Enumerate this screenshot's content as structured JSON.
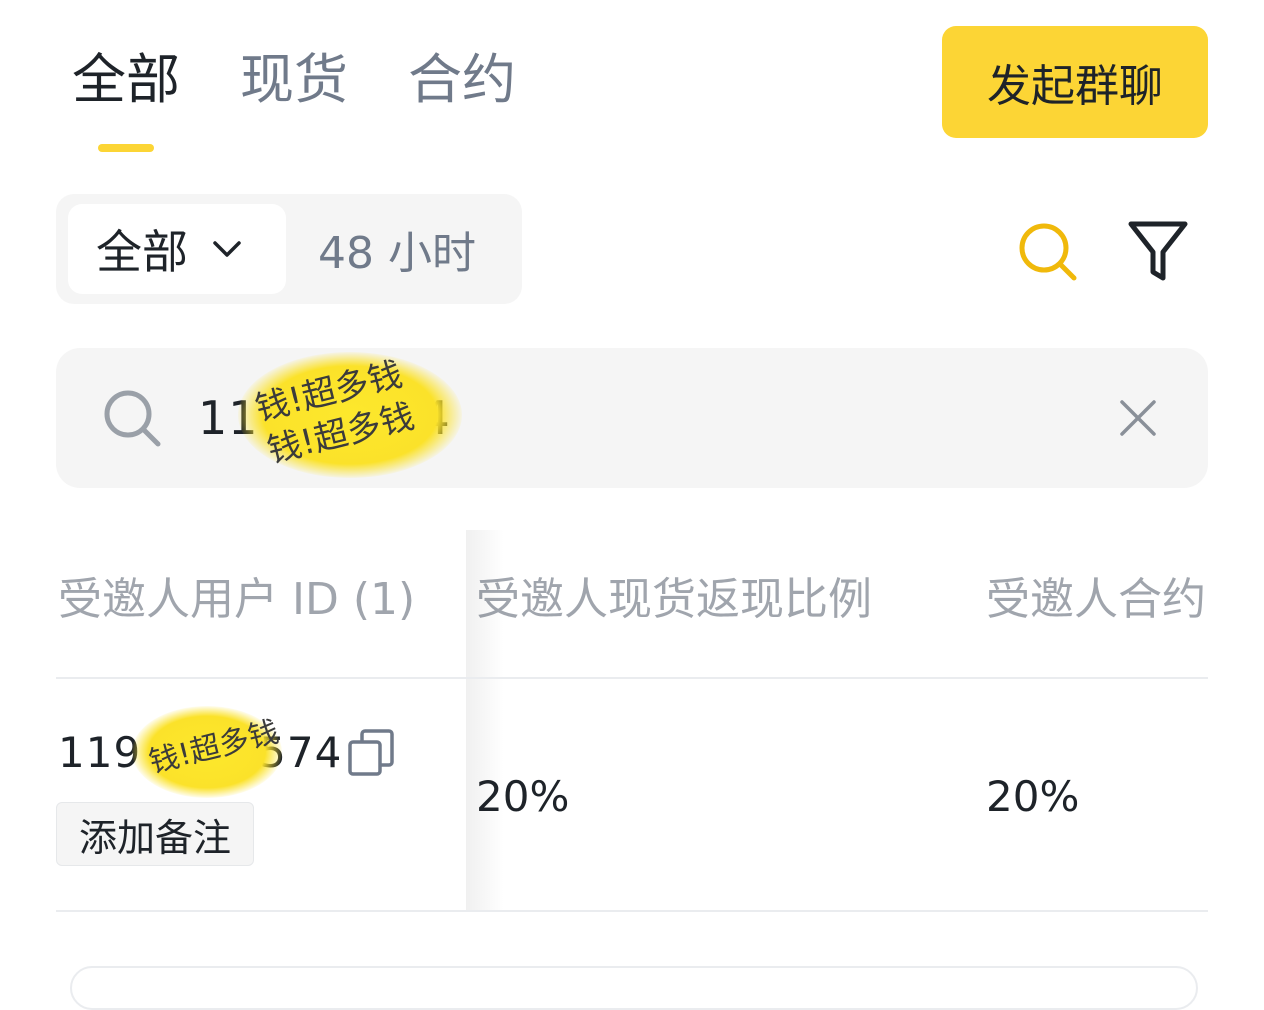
{
  "tabs": [
    {
      "label": "全部",
      "active": true
    },
    {
      "label": "现货",
      "active": false
    },
    {
      "label": "合约",
      "active": false
    }
  ],
  "header": {
    "group_chat_label": "发起群聊"
  },
  "segment": {
    "dropdown_label": "全部",
    "option_label": "48 小时"
  },
  "search": {
    "value": "119…74",
    "value_visible_start": "11",
    "value_visible_end": "4"
  },
  "table": {
    "columns": [
      "受邀人用户 ID (1)",
      "受邀人现货返现比例",
      "受邀人合约"
    ],
    "rows": [
      {
        "user_id_start": "119",
        "user_id_end": "574",
        "note_label": "添加备注",
        "spot_ratio": "20%",
        "futures_ratio": "20%"
      }
    ]
  },
  "overlay": {
    "scribble_text": "钱!超多钱"
  },
  "colors": {
    "accent": "#fcd535",
    "text_primary": "#1e2329",
    "text_secondary": "#707a8a",
    "surface": "#f5f5f5"
  },
  "icons": [
    "search-icon",
    "filter-icon",
    "chevron-down-icon",
    "close-icon",
    "copy-icon"
  ]
}
